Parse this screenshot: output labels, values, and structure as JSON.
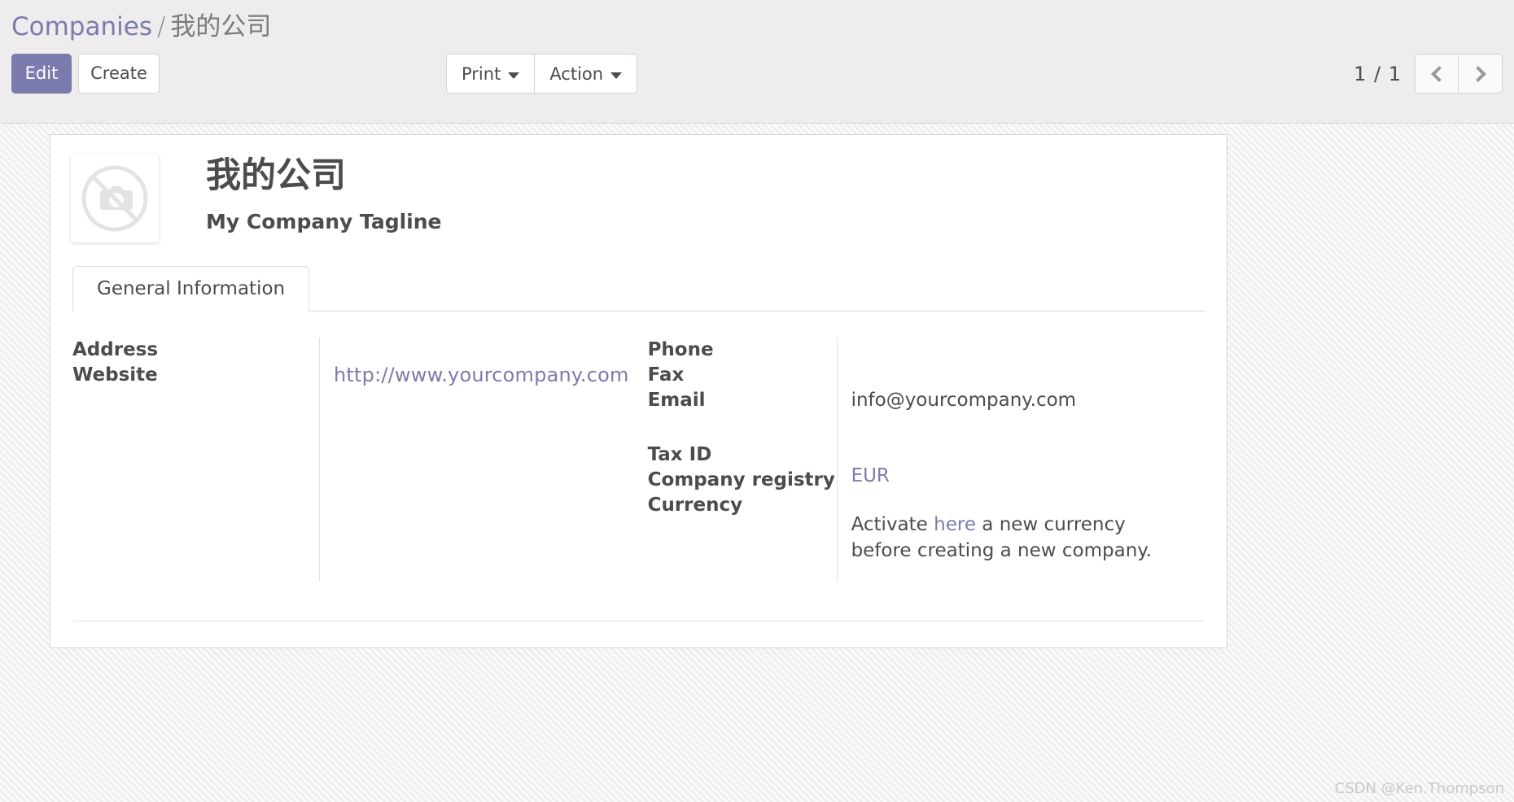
{
  "breadcrumb": {
    "root": "Companies",
    "separator": "/",
    "current": "我的公司"
  },
  "toolbar": {
    "edit_label": "Edit",
    "create_label": "Create",
    "print_label": "Print",
    "action_label": "Action"
  },
  "pager": {
    "count": "1 / 1",
    "prev_icon": "chevron-left-icon",
    "next_icon": "chevron-right-icon"
  },
  "record": {
    "avatar_icon": "no-camera-placeholder-icon",
    "name": "我的公司",
    "tagline": "My Company Tagline"
  },
  "notebook": {
    "tabs": [
      {
        "label": "General Information",
        "active": true
      }
    ]
  },
  "form": {
    "left": {
      "labels": [
        "Address",
        "Website"
      ],
      "values": {
        "address": "",
        "website": "http://www.yourcompany.com"
      }
    },
    "right": {
      "labels": [
        "Phone",
        "Fax",
        "Email",
        "Tax ID",
        "Company registry",
        "Currency"
      ],
      "values": {
        "phone": "",
        "fax": "",
        "email": "info@yourcompany.com",
        "tax_id": "",
        "company_registry": "",
        "currency": "EUR"
      },
      "currency_help": {
        "prefix": "Activate ",
        "link": "here",
        "suffix": " a new currency before creating a new company."
      }
    }
  },
  "watermark": "CSDN @Ken.Thompson",
  "colors": {
    "accent": "#7c7bad",
    "panel_bg": "#eeecec",
    "text": "#4c4c4c",
    "border": "#d2d2d2"
  }
}
